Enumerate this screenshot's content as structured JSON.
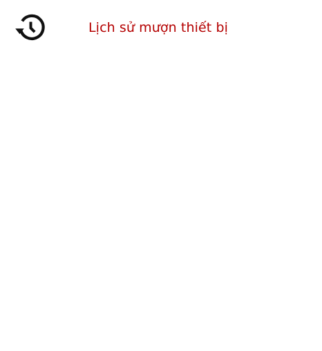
{
  "header": {
    "icon": "history-icon",
    "title": "Lịch sử mượn thiết bị"
  },
  "colors": {
    "title": "#b40000",
    "icon": "#111111",
    "background": "#ffffff"
  }
}
